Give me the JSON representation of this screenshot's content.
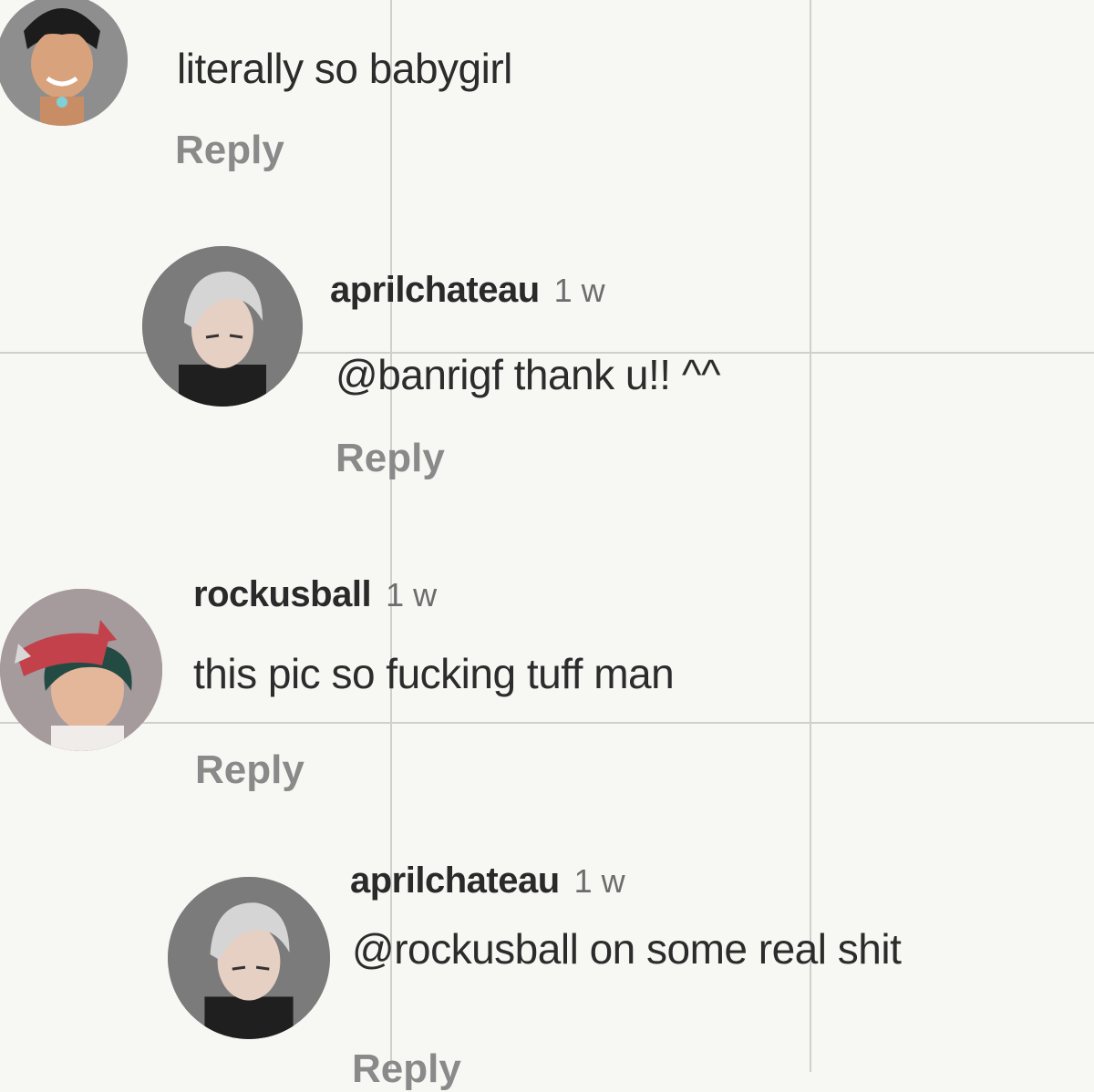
{
  "comments": [
    {
      "text": "literally so babygirl",
      "reply_label": "Reply",
      "avatar_icon": "anime-boy-avatar"
    },
    {
      "username": "aprilchateau",
      "time": "1 w",
      "text": "@banrigf thank u!! ^^",
      "reply_label": "Reply",
      "avatar_icon": "silver-hair-avatar"
    },
    {
      "username": "rockusball",
      "time": "1 w",
      "text": "this pic so fucking tuff man",
      "reply_label": "Reply",
      "avatar_icon": "helmet-girl-avatar"
    },
    {
      "username": "aprilchateau",
      "time": "1 w",
      "text": "@rockusball on some real shit",
      "reply_label": "Reply",
      "avatar_icon": "silver-hair-avatar"
    }
  ],
  "colors": {
    "background": "#f7f7f4",
    "grid": "#cfcfcc",
    "username": "#2a2a2a",
    "reply": "#8a8a8a"
  }
}
